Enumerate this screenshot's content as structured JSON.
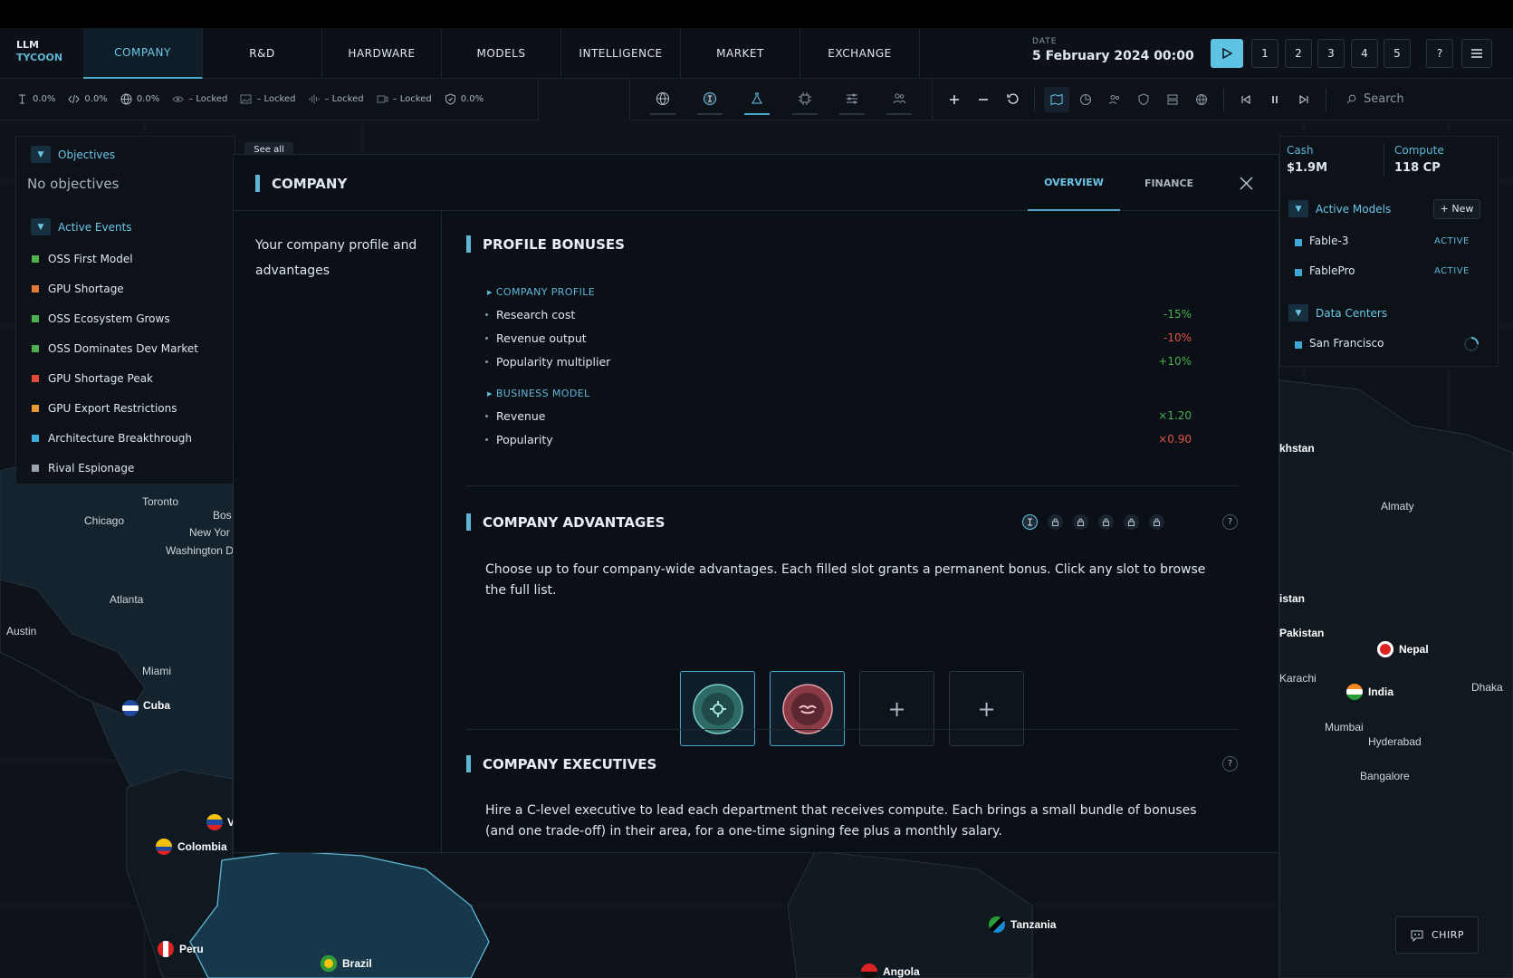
{
  "app": {
    "title_line1": "LLM",
    "title_line2": "TYCOON"
  },
  "nav": {
    "tabs": [
      "COMPANY",
      "R&D",
      "HARDWARE",
      "MODELS",
      "INTELLIGENCE",
      "MARKET",
      "EXCHANGE"
    ],
    "active_tab": "COMPANY"
  },
  "date": {
    "label": "DATE",
    "value": "5 February 2024  00:00"
  },
  "speed": {
    "buttons": [
      "1",
      "2",
      "3",
      "4",
      "5"
    ],
    "help": "?"
  },
  "stats": [
    {
      "icon": "text-cursor-icon",
      "value": "0.0%"
    },
    {
      "icon": "code-icon",
      "value": "0.0%"
    },
    {
      "icon": "globe-icon",
      "value": "0.0%"
    },
    {
      "icon": "eye-icon",
      "value": "– Locked"
    },
    {
      "icon": "image-icon",
      "value": "– Locked"
    },
    {
      "icon": "audio-icon",
      "value": "– Locked"
    },
    {
      "icon": "video-icon",
      "value": "– Locked"
    },
    {
      "icon": "shield-icon",
      "value": "0.0%"
    }
  ],
  "toolbar": {
    "search_placeholder": "Search"
  },
  "objectives": {
    "title": "Objectives",
    "empty": "No objectives",
    "see_all": "See all"
  },
  "events": {
    "title": "Active Events",
    "items": [
      {
        "label": "OSS First Model",
        "color": "#4caf50"
      },
      {
        "label": "GPU Shortage",
        "color": "#e07b39"
      },
      {
        "label": "OSS Ecosystem Grows",
        "color": "#4caf50"
      },
      {
        "label": "OSS Dominates Dev Market",
        "color": "#4caf50"
      },
      {
        "label": "GPU Shortage Peak",
        "color": "#e04b3a"
      },
      {
        "label": "GPU Export Restrictions",
        "color": "#e59a2f"
      },
      {
        "label": "Architecture Breakthrough",
        "color": "#3ea8d8"
      },
      {
        "label": "Rival Espionage",
        "color": "#9aa4ae"
      }
    ]
  },
  "resources": {
    "cash_label": "Cash",
    "cash_value": "$1.9M",
    "compute_label": "Compute",
    "compute_value": "118 CP"
  },
  "models": {
    "title": "Active Models",
    "new_button": "+ New",
    "items": [
      {
        "name": "Fable-3",
        "status": "ACTIVE"
      },
      {
        "name": "FablePro",
        "status": "ACTIVE"
      }
    ]
  },
  "datacenters": {
    "title": "Data Centers",
    "items": [
      {
        "name": "San Francisco"
      }
    ]
  },
  "modal": {
    "title": "COMPANY",
    "tabs": [
      "OVERVIEW",
      "FINANCE"
    ],
    "side_text": "Your company profile and advantages",
    "profile": {
      "title": "PROFILE BONUSES",
      "company_profile_label": "COMPANY PROFILE",
      "company_rows": [
        {
          "label": "Research cost",
          "value": "-15%",
          "color": "#4caf50"
        },
        {
          "label": "Revenue output",
          "value": "-10%",
          "color": "#e0524a"
        },
        {
          "label": "Popularity multiplier",
          "value": "+10%",
          "color": "#4caf50"
        }
      ],
      "business_model_label": "BUSINESS MODEL",
      "business_rows": [
        {
          "label": "Revenue",
          "value": "×1.20",
          "color": "#4caf50"
        },
        {
          "label": "Popularity",
          "value": "×0.90",
          "color": "#e0524a"
        }
      ]
    },
    "advantages": {
      "title": "COMPANY ADVANTAGES",
      "text": "Choose up to four company-wide advantages. Each filled slot grants a permanent bonus. Click any slot to browse the full list.",
      "plus": "+"
    },
    "executives": {
      "title": "COMPANY EXECUTIVES",
      "text": "Hire a C-level executive to lead each department that receives compute. Each brings a small bundle of bonuses (and one trade-off) in their area, for a one-time signing fee plus a monthly salary."
    }
  },
  "map_labels": [
    "Toronto",
    "Chicago",
    "Bos",
    "New Yor",
    "Washington D",
    "Atlanta",
    "Austin",
    "Miami",
    "Cuba",
    "Colombia",
    "Peru",
    "Brazil",
    "Tanzania",
    "Angola",
    "Nepal",
    "India",
    "Dhaka",
    "Karachi",
    "Mumbai",
    "Hyderabad",
    "Bangalore",
    "Almaty",
    "khstan",
    "istan",
    "Pakistan",
    "V"
  ],
  "chirp": "CHIRP"
}
